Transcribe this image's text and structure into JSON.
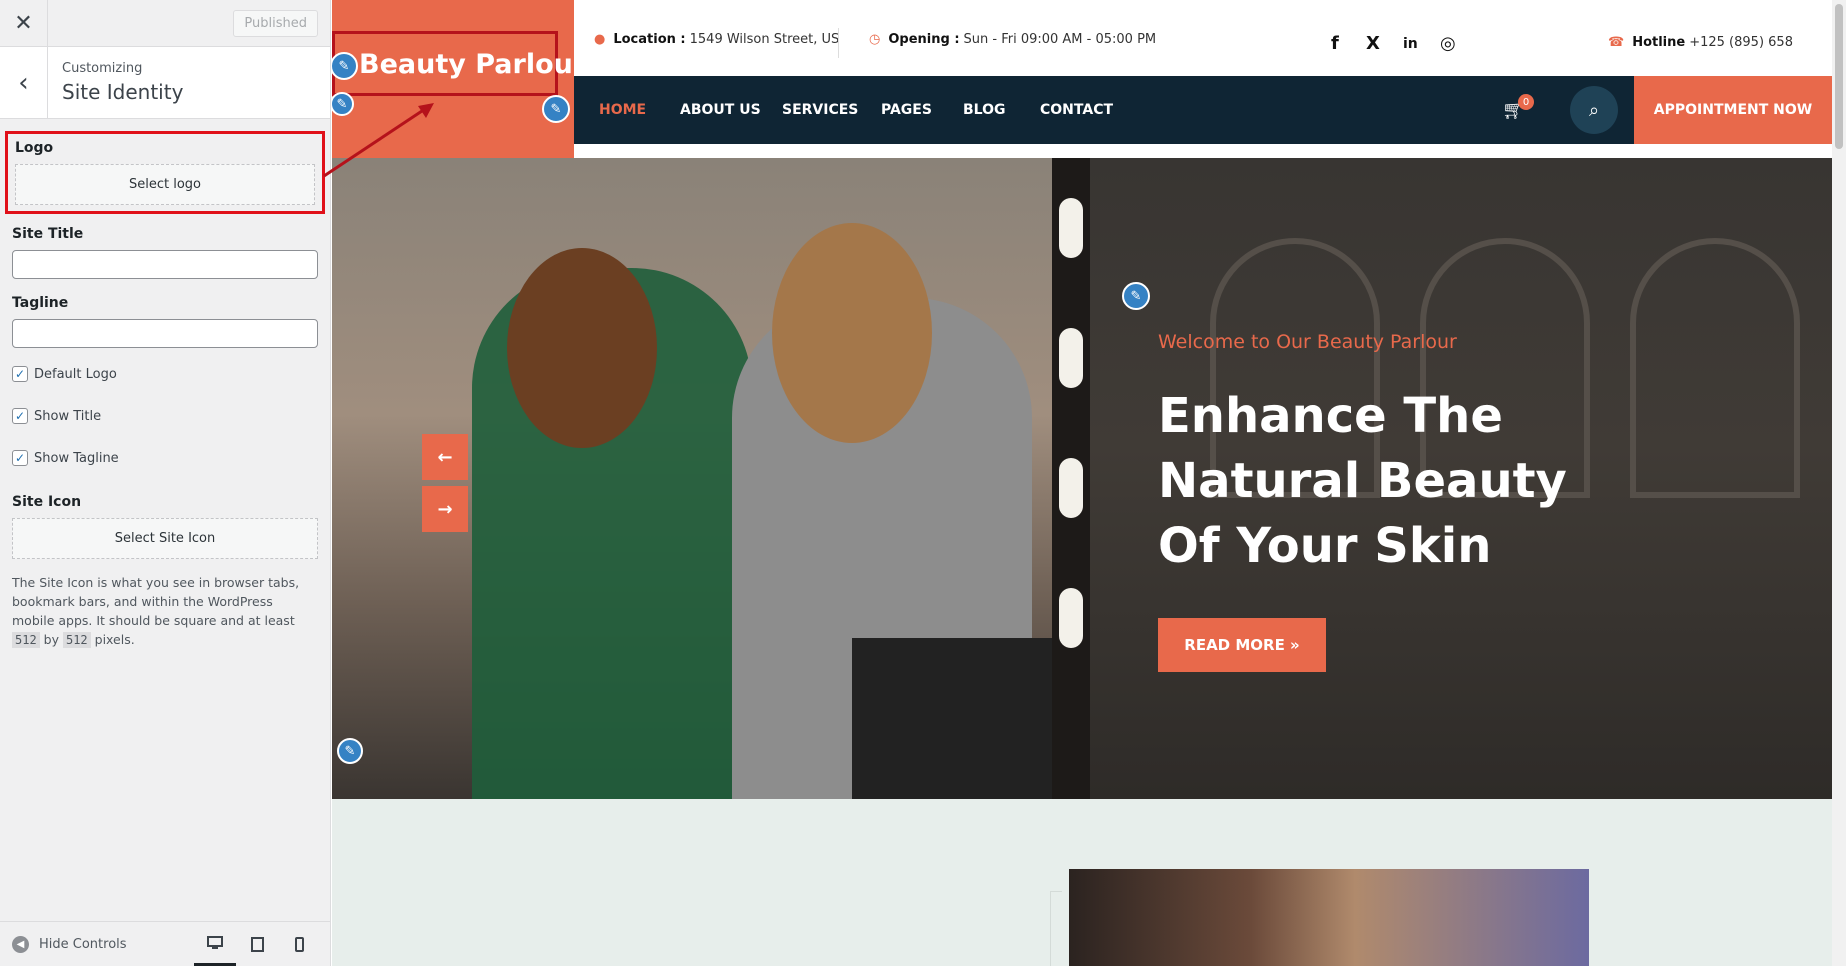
{
  "customizer": {
    "close_icon": "close-icon",
    "publish_label": "Published",
    "back_icon": "chevron-left-icon",
    "section_small": "Customizing",
    "section_title": "Site Identity",
    "logo": {
      "title": "Logo",
      "button": "Select logo"
    },
    "site_title": {
      "label": "Site Title",
      "value": ""
    },
    "tagline": {
      "label": "Tagline",
      "value": ""
    },
    "checks": [
      {
        "label": "Default Logo",
        "checked": true
      },
      {
        "label": "Show Title",
        "checked": true
      },
      {
        "label": "Show Tagline",
        "checked": true
      }
    ],
    "site_icon": {
      "title": "Site Icon",
      "button": "Select Site Icon",
      "desc_before": "The Site Icon is what you see in browser tabs, bookmark bars, and within the WordPress mobile apps. It should be square and at least ",
      "code1": "512",
      "desc_mid": " by ",
      "code2": "512",
      "desc_after": " pixels."
    },
    "footer": {
      "hide_label": "Hide Controls"
    }
  },
  "site": {
    "logo_text": "Beauty Parlour",
    "topbar": {
      "location_label": "Location :",
      "location_value": "1549 Wilson Street, US",
      "opening_label": "Opening :",
      "opening_value": "Sun - Fri 09:00 AM - 05:00 PM",
      "hotline_label": "Hotline",
      "hotline_value": "+125 (895) 658",
      "social": [
        "f",
        "X",
        "in",
        "◎"
      ]
    },
    "nav": [
      "HOME",
      "ABOUT US",
      "SERVICES",
      "PAGES",
      "BLOG",
      "CONTACT"
    ],
    "cart_count": "0",
    "appointment": "APPOINTMENT NOW",
    "hero": {
      "welcome": "Welcome to Our Beauty Parlour",
      "title": "Enhance The Natural Beauty Of Your Skin",
      "read_more": "READ MORE »"
    }
  },
  "colors": {
    "accent": "#e8694b",
    "nav_bg": "#0f2534",
    "highlight": "#e0101a",
    "edit_pencil": "#3582c4"
  }
}
